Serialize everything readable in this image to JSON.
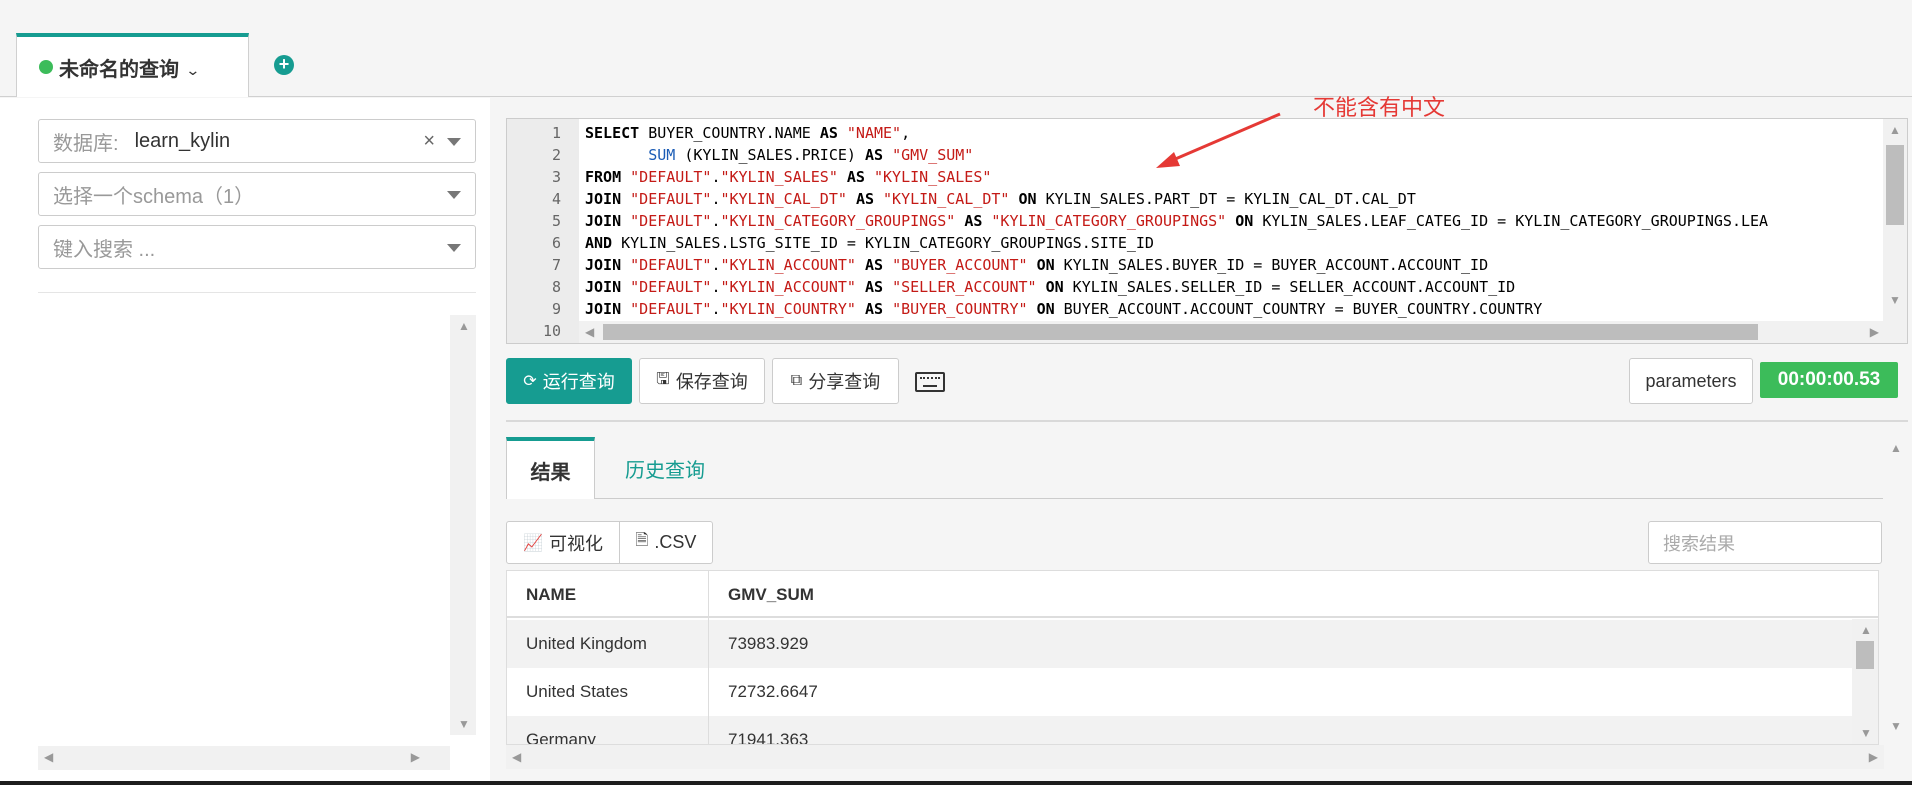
{
  "query_tab": {
    "title": "未命名的查询"
  },
  "left": {
    "database": {
      "label": "数据库:",
      "value": "learn_kylin",
      "clear": "×"
    },
    "schema": {
      "placeholder": "选择一个schema（1）"
    },
    "search": {
      "placeholder": "键入搜索 ..."
    }
  },
  "editor": {
    "line_numbers": [
      "1",
      "2",
      "3",
      "4",
      "5",
      "6",
      "7",
      "8",
      "9",
      "10"
    ]
  },
  "annotation": "不能含有中文",
  "toolbar": {
    "run": "运行查询",
    "save": "保存查询",
    "share": "分享查询",
    "parameters": "parameters",
    "elapsed": "00:00:00.53"
  },
  "results": {
    "tabs": [
      "结果",
      "历史查询"
    ],
    "visualize": "可视化",
    "csv": ".CSV",
    "search_placeholder": "搜索结果",
    "columns": [
      "NAME",
      "GMV_SUM"
    ],
    "rows": [
      [
        "United Kingdom",
        "73983.929"
      ],
      [
        "United States",
        "72732.6647"
      ],
      [
        "Germany",
        "71941.363"
      ]
    ]
  },
  "colors": {
    "accent": "#169c91",
    "success": "#3cbc5a",
    "annotation": "#e53935"
  }
}
